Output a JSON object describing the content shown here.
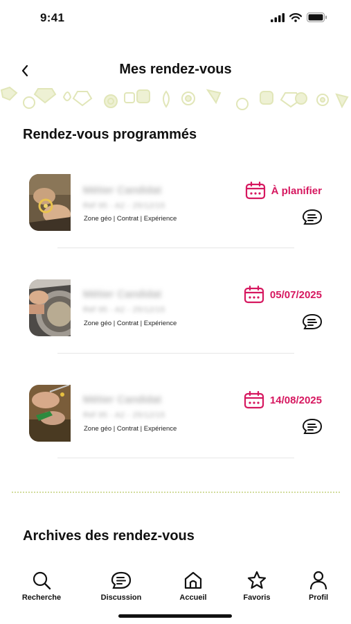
{
  "status_bar": {
    "time": "9:41"
  },
  "header": {
    "title": "Mes rendez-vous"
  },
  "sections": {
    "scheduled_title": "Rendez-vous programmés",
    "archives_title": "Archives des rendez-vous"
  },
  "appointments": [
    {
      "name": "Métier Candidat",
      "ref": "Réf 95 - A2 - 25/12/15",
      "meta": "Zone géo | Contrat | Expérience",
      "status": "À planifier",
      "thumb": "jeweler-hands-ring"
    },
    {
      "name": "Métier Candidat",
      "ref": "Réf 95 - A2 - 25/12/15",
      "meta": "Zone géo | Contrat | Expérience",
      "status": "05/07/2025",
      "thumb": "jeweler-polishing-wheel"
    },
    {
      "name": "Métier Candidat",
      "ref": "Réf 95 - A2 - 25/12/15",
      "meta": "Zone géo | Contrat | Expérience",
      "status": "14/08/2025",
      "thumb": "jeweler-setting-stone"
    }
  ],
  "tabs": [
    {
      "label": "Recherche",
      "icon": "search-icon"
    },
    {
      "label": "Discussion",
      "icon": "chat-icon"
    },
    {
      "label": "Accueil",
      "icon": "home-icon"
    },
    {
      "label": "Favoris",
      "icon": "star-icon"
    },
    {
      "label": "Profil",
      "icon": "profile-icon"
    }
  ],
  "colors": {
    "accent": "#d6175f",
    "decoration": "#d2dc9c"
  }
}
